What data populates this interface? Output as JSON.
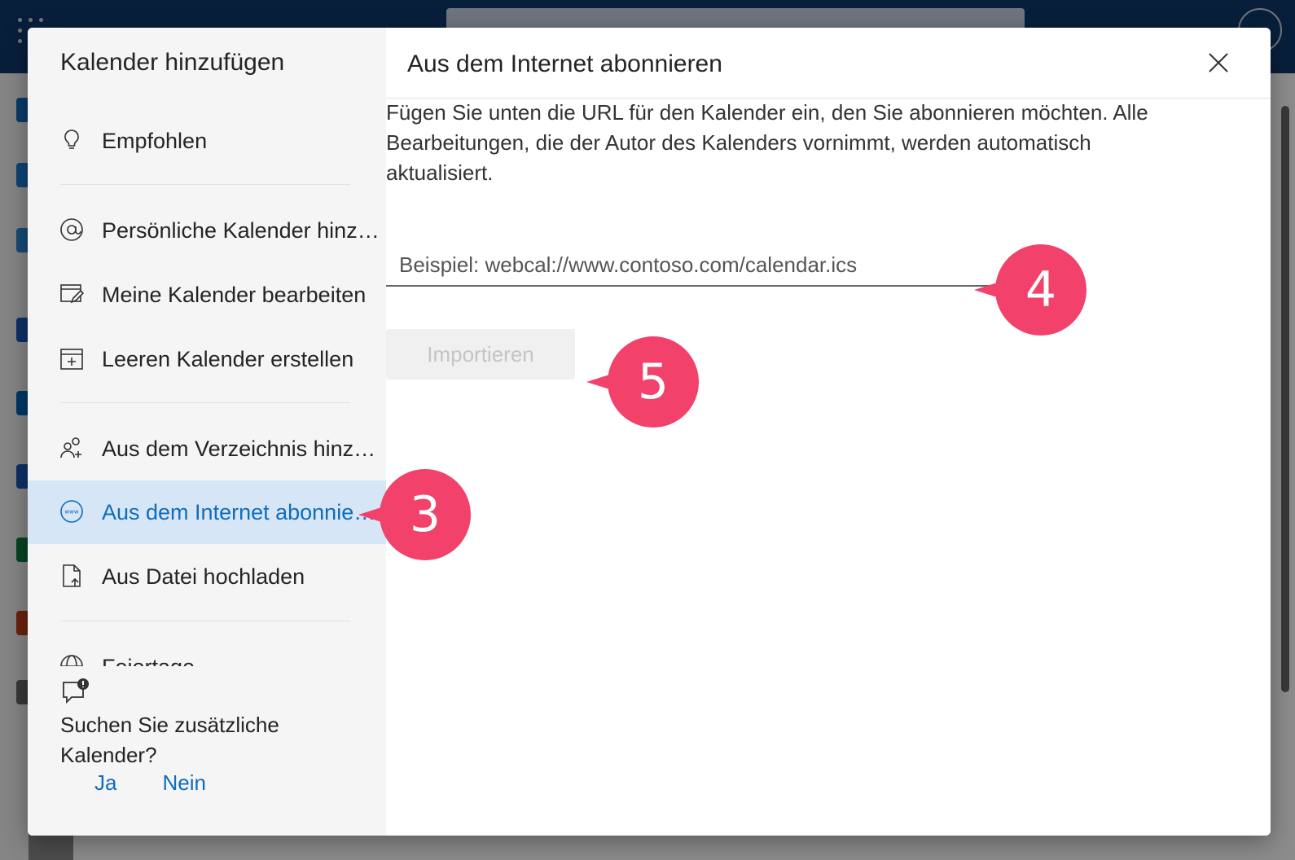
{
  "dialog": {
    "sidebar_title": "Kalender hinzufügen",
    "nav": [
      {
        "label": "Empfohlen",
        "icon": "lightbulb-icon"
      },
      {
        "label": "Persönliche Kalender hinzufügen",
        "icon": "at-icon"
      },
      {
        "label": "Meine Kalender bearbeiten",
        "icon": "edit-calendar-icon"
      },
      {
        "label": "Leeren Kalender erstellen",
        "icon": "add-calendar-icon"
      },
      {
        "label": "Aus dem Verzeichnis hinzufügen",
        "icon": "people-add-icon"
      },
      {
        "label": "Aus dem Internet abonnieren",
        "icon": "globe-www-icon",
        "active": true
      },
      {
        "label": "Aus Datei hochladen",
        "icon": "file-upload-icon"
      },
      {
        "label": "Feiertage",
        "icon": "globe-icon"
      }
    ],
    "feedback": {
      "text": "Suchen Sie zusätzliche Kalender?",
      "yes": "Ja",
      "no": "Nein"
    },
    "main_title": "Aus dem Internet abonnieren",
    "description": "Fügen Sie unten die URL für den Kalender ein, den Sie abonnieren möchten. Alle Bearbeitungen, die der Autor des Kalenders vornimmt, werden automatisch aktualisiert.",
    "url_placeholder": "Beispiel: webcal://www.contoso.com/calendar.ics",
    "url_value": "",
    "import_label": "Importieren"
  },
  "callouts": {
    "three": "3",
    "four": "4",
    "five": "5"
  },
  "colors": {
    "accent": "#0f6cbd",
    "callout": "#f2416b",
    "active_bg": "#d6e6f6"
  }
}
